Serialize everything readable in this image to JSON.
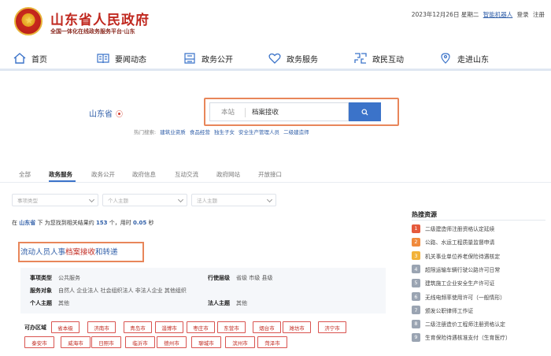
{
  "header": {
    "site_title": "山东省人民政府",
    "site_subtitle": "全国一体化在线政务服务平台·山东",
    "date_text": "2023年12月26日 星期二",
    "robot_link": "智能机器人",
    "login": "登录",
    "register": "注册"
  },
  "nav": {
    "items": [
      {
        "label": "首页",
        "icon": "home-icon"
      },
      {
        "label": "要闻动态",
        "icon": "news-book-icon"
      },
      {
        "label": "政务公开",
        "icon": "open-government-icon"
      },
      {
        "label": "政务服务",
        "icon": "heart-service-icon"
      },
      {
        "label": "政民互动",
        "icon": "interaction-icon"
      },
      {
        "label": "走进山东",
        "icon": "visit-shandong-icon"
      }
    ]
  },
  "search": {
    "region": "山东省",
    "scope": "本站",
    "query": "档案接收",
    "hot_label": "热门搜索:",
    "hot_terms": [
      "建筑业资质",
      "食品经营",
      "独生子女",
      "安全生产管理人员",
      "二级建造师"
    ]
  },
  "tabs": {
    "items": [
      "全部",
      "政务服务",
      "政务公开",
      "政府信息",
      "互动交流",
      "政府网站",
      "开放接口"
    ],
    "active": "政务服务"
  },
  "filters": [
    "事项类型",
    "个人主题",
    "法人主题"
  ],
  "results": {
    "prefix": "在",
    "region": "山东省",
    "middle": "下 为您找到相关结果约",
    "count": "153",
    "unit": "个，用时",
    "time": "0.05",
    "suffix": "秒"
  },
  "result": {
    "title_pre": "流动人员人事",
    "title_hl": "档案接收",
    "title_post": "和转递",
    "item_type_label": "事项类型",
    "item_type": "公共服务",
    "level_label": "行使层级",
    "level": "省级 市级 县级",
    "target_label": "服务对象",
    "target": "自然人 企业法人 社会组织法人 非法人企业 其他组织",
    "personal_label": "个人主题",
    "personal": "其他",
    "legal_label": "法人主题",
    "legal": "其他",
    "area_label": "可办区域",
    "cities": [
      "省本级",
      "济南市",
      "青岛市",
      "淄博市",
      "枣庄市",
      "东营市",
      "烟台市",
      "潍坊市",
      "济宁市",
      "泰安市",
      "威海市",
      "日照市",
      "临沂市",
      "德州市",
      "聊城市",
      "滨州市",
      "菏泽市"
    ]
  },
  "sidebar": {
    "title": "热搜资源",
    "items": [
      {
        "num": "1",
        "text": "二级建造师注册资格认定延续"
      },
      {
        "num": "2",
        "text": "公路、水运工程质量监督申请"
      },
      {
        "num": "3",
        "text": "机关事业单位养老保险待遇核定"
      },
      {
        "num": "4",
        "text": "超限运输车辆行驶公路许可日常"
      },
      {
        "num": "5",
        "text": "建筑施工企业安全生产许可证"
      },
      {
        "num": "6",
        "text": "无线电频率使用许可（一般情形）"
      },
      {
        "num": "7",
        "text": "颁发公职律师工作证"
      },
      {
        "num": "8",
        "text": "二级注册造价工程师注册资格认定"
      },
      {
        "num": "9",
        "text": "生育保险待遇核准支付（生育医疗）"
      }
    ],
    "rank_colors": [
      "#e55a3c",
      "#f08a3c",
      "#f2b23a",
      "#9aa4b2"
    ]
  },
  "colors": {
    "brand_red": "#c0281f",
    "link_blue": "#2f5ea8",
    "button_blue": "#3b73c9",
    "highlight_frame": "#e8865a"
  }
}
